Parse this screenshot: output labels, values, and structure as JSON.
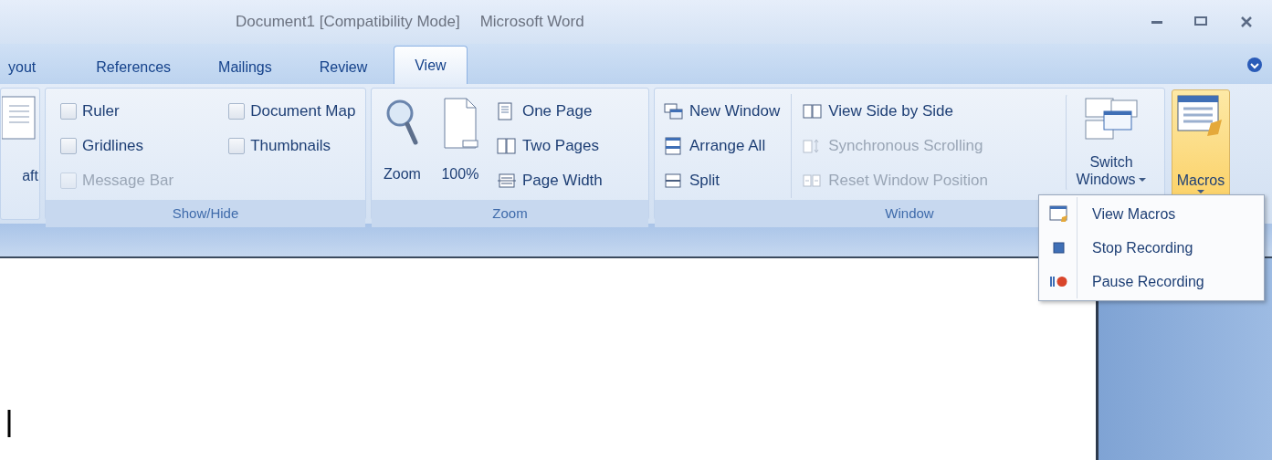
{
  "window": {
    "title": "Document1 [Compatibility Mode]",
    "app": "Microsoft Word"
  },
  "tabs": [
    {
      "label": "yout",
      "selected": false
    },
    {
      "label": "References",
      "selected": false
    },
    {
      "label": "Mailings",
      "selected": false
    },
    {
      "label": "Review",
      "selected": false
    },
    {
      "label": "View",
      "selected": true
    }
  ],
  "ribbon": {
    "groups": [
      {
        "kind": "partial",
        "large": [
          {
            "label": "aft"
          }
        ]
      },
      {
        "kind": "checks",
        "label": "Show/Hide",
        "columns": [
          [
            {
              "label": "Ruler",
              "checked": false,
              "disabled": false
            },
            {
              "label": "Gridlines",
              "checked": false,
              "disabled": false
            },
            {
              "label": "Message Bar",
              "checked": false,
              "disabled": true
            }
          ],
          [
            {
              "label": "Document Map",
              "checked": false,
              "disabled": false
            },
            {
              "label": "Thumbnails",
              "checked": false,
              "disabled": false
            }
          ]
        ]
      },
      {
        "kind": "zoom",
        "label": "Zoom",
        "large": [
          {
            "label": "Zoom"
          },
          {
            "label": "100%"
          }
        ],
        "columns": [
          [
            {
              "label": "One Page",
              "disabled": false
            },
            {
              "label": "Two Pages",
              "disabled": false
            },
            {
              "label": "Page Width",
              "disabled": false
            }
          ]
        ]
      },
      {
        "kind": "window",
        "label": "Window",
        "columns": [
          [
            {
              "label": "New Window",
              "disabled": false
            },
            {
              "label": "Arrange All",
              "disabled": false
            },
            {
              "label": "Split",
              "disabled": false
            }
          ],
          [
            {
              "label": "View Side by Side",
              "disabled": false
            },
            {
              "label": "Synchronous Scrolling",
              "disabled": true
            },
            {
              "label": "Reset Window Position",
              "disabled": true
            }
          ]
        ],
        "large": [
          {
            "label": "Switch Windows",
            "dropdown": true,
            "expanded": false
          }
        ]
      },
      {
        "kind": "macros",
        "large": [
          {
            "label": "Macros",
            "dropdown": true,
            "expanded": true
          }
        ]
      }
    ]
  },
  "menu": {
    "items": [
      {
        "label": "View Macros"
      },
      {
        "label": "Stop Recording"
      },
      {
        "label": "Pause Recording"
      }
    ]
  }
}
